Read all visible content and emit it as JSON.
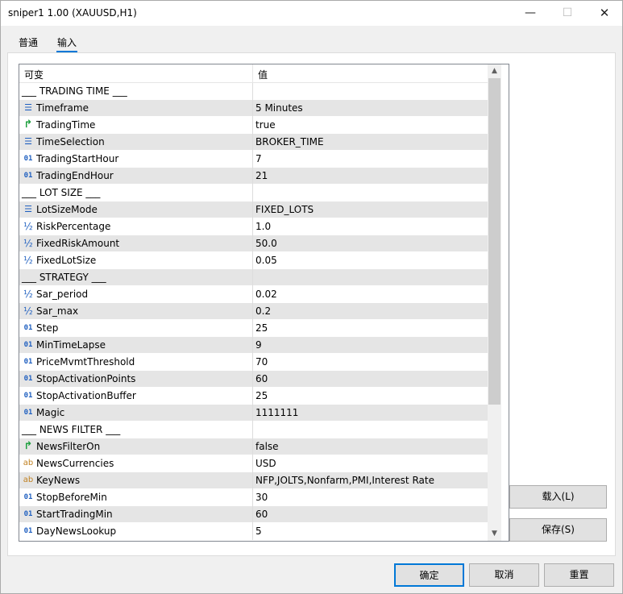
{
  "window": {
    "title": "sniper1 1.00 (XAUUSD,H1)",
    "minimize_glyph": "—",
    "maximize_glyph": "☐",
    "close_glyph": "✕"
  },
  "tabs": [
    {
      "label": "普通",
      "active": false
    },
    {
      "label": "输入",
      "active": true
    }
  ],
  "grid": {
    "headers": {
      "variable": "可变",
      "value": "值"
    },
    "rows": [
      {
        "type": "section",
        "name": "___ TRADING TIME ___",
        "value": ""
      },
      {
        "type": "enum",
        "name": "Timeframe",
        "value": "5 Minutes"
      },
      {
        "type": "bool",
        "name": "TradingTime",
        "value": "true"
      },
      {
        "type": "enum",
        "name": "TimeSelection",
        "value": "BROKER_TIME"
      },
      {
        "type": "int",
        "name": "TradingStartHour",
        "value": "7"
      },
      {
        "type": "int",
        "name": "TradingEndHour",
        "value": "21"
      },
      {
        "type": "section",
        "name": "___ LOT SIZE ___",
        "value": ""
      },
      {
        "type": "enum",
        "name": "LotSizeMode",
        "value": "FIXED_LOTS"
      },
      {
        "type": "dbl",
        "name": "RiskPercentage",
        "value": "1.0"
      },
      {
        "type": "dbl",
        "name": "FixedRiskAmount",
        "value": "50.0"
      },
      {
        "type": "dbl",
        "name": "FixedLotSize",
        "value": "0.05"
      },
      {
        "type": "section",
        "name": "___ STRATEGY ___",
        "value": ""
      },
      {
        "type": "dbl",
        "name": "Sar_period",
        "value": "0.02"
      },
      {
        "type": "dbl",
        "name": "Sar_max",
        "value": "0.2"
      },
      {
        "type": "int",
        "name": "Step",
        "value": "25"
      },
      {
        "type": "int",
        "name": "MinTimeLapse",
        "value": "9"
      },
      {
        "type": "int",
        "name": "PriceMvmtThreshold",
        "value": "70"
      },
      {
        "type": "int",
        "name": "StopActivationPoints",
        "value": "60"
      },
      {
        "type": "int",
        "name": "StopActivationBuffer",
        "value": "25"
      },
      {
        "type": "int",
        "name": "Magic",
        "value": "1111111"
      },
      {
        "type": "section",
        "name": "___ NEWS FILTER ___",
        "value": ""
      },
      {
        "type": "bool",
        "name": "NewsFilterOn",
        "value": "false"
      },
      {
        "type": "str",
        "name": "NewsCurrencies",
        "value": "USD"
      },
      {
        "type": "str",
        "name": "KeyNews",
        "value": "NFP,JOLTS,Nonfarm,PMI,Interest Rate"
      },
      {
        "type": "int",
        "name": "StopBeforeMin",
        "value": "30"
      },
      {
        "type": "int",
        "name": "StartTradingMin",
        "value": "60"
      },
      {
        "type": "int",
        "name": "DayNewsLookup",
        "value": "5"
      }
    ]
  },
  "buttons": {
    "load": "载入(L)",
    "save": "保存(S)",
    "ok": "确定",
    "cancel": "取消",
    "reset": "重置"
  },
  "scrollbar": {
    "up_glyph": "▲",
    "down_glyph": "▼"
  }
}
